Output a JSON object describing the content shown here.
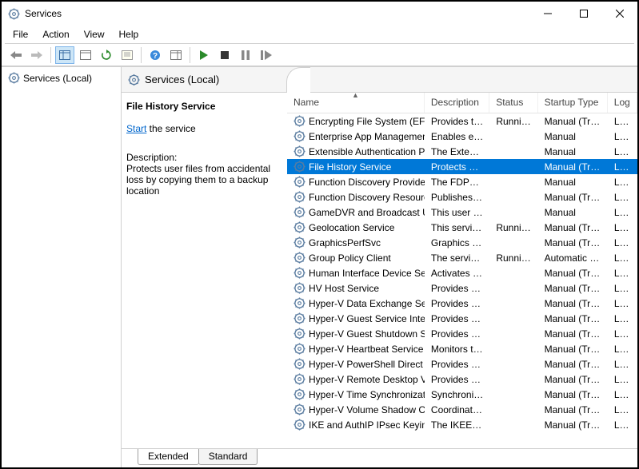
{
  "window": {
    "title": "Services"
  },
  "menu": {
    "file": "File",
    "action": "Action",
    "view": "View",
    "help": "Help"
  },
  "tree": {
    "root": "Services (Local)"
  },
  "header": {
    "title": "Services (Local)"
  },
  "detail": {
    "title": "File History Service",
    "start_label": "Start",
    "start_tail": " the service",
    "desc_head": "Description:",
    "desc_body": "Protects user files from accidental loss by copying them to a backup location"
  },
  "columns": {
    "name": "Name",
    "description": "Description",
    "status": "Status",
    "startup": "Startup Type",
    "logon": "Log"
  },
  "rows": [
    {
      "name": "Encrypting File System (EFS)",
      "desc": "Provides th...",
      "status": "Running",
      "startup": "Manual (Trig...",
      "logon": "Loca",
      "selected": false
    },
    {
      "name": "Enterprise App Managemen...",
      "desc": "Enables ent...",
      "status": "",
      "startup": "Manual",
      "logon": "Loca",
      "selected": false
    },
    {
      "name": "Extensible Authentication P...",
      "desc": "The Extensi...",
      "status": "",
      "startup": "Manual",
      "logon": "Loca",
      "selected": false
    },
    {
      "name": "File History Service",
      "desc": "Protects use...",
      "status": "",
      "startup": "Manual (Trig...",
      "logon": "Loca",
      "selected": true
    },
    {
      "name": "Function Discovery Provide...",
      "desc": "The FDPHO...",
      "status": "",
      "startup": "Manual",
      "logon": "Loca",
      "selected": false
    },
    {
      "name": "Function Discovery Resourc...",
      "desc": "Publishes th...",
      "status": "",
      "startup": "Manual (Trig...",
      "logon": "Loca",
      "selected": false
    },
    {
      "name": "GameDVR and Broadcast Us...",
      "desc": "This user ser...",
      "status": "",
      "startup": "Manual",
      "logon": "Loca",
      "selected": false
    },
    {
      "name": "Geolocation Service",
      "desc": "This service ...",
      "status": "Running",
      "startup": "Manual (Trig...",
      "logon": "Loca",
      "selected": false
    },
    {
      "name": "GraphicsPerfSvc",
      "desc": "Graphics pe...",
      "status": "",
      "startup": "Manual (Trig...",
      "logon": "Loca",
      "selected": false
    },
    {
      "name": "Group Policy Client",
      "desc": "The service i...",
      "status": "Running",
      "startup": "Automatic (T...",
      "logon": "Loca",
      "selected": false
    },
    {
      "name": "Human Interface Device Ser...",
      "desc": "Activates an...",
      "status": "",
      "startup": "Manual (Trig...",
      "logon": "Loca",
      "selected": false
    },
    {
      "name": "HV Host Service",
      "desc": "Provides an ...",
      "status": "",
      "startup": "Manual (Trig...",
      "logon": "Loca",
      "selected": false
    },
    {
      "name": "Hyper-V Data Exchange Ser...",
      "desc": "Provides a ...",
      "status": "",
      "startup": "Manual (Trig...",
      "logon": "Loca",
      "selected": false
    },
    {
      "name": "Hyper-V Guest Service Inter...",
      "desc": "Provides an ...",
      "status": "",
      "startup": "Manual (Trig...",
      "logon": "Loca",
      "selected": false
    },
    {
      "name": "Hyper-V Guest Shutdown S...",
      "desc": "Provides a ...",
      "status": "",
      "startup": "Manual (Trig...",
      "logon": "Loca",
      "selected": false
    },
    {
      "name": "Hyper-V Heartbeat Service",
      "desc": "Monitors th...",
      "status": "",
      "startup": "Manual (Trig...",
      "logon": "Loca",
      "selected": false
    },
    {
      "name": "Hyper-V PowerShell Direct ...",
      "desc": "Provides a ...",
      "status": "",
      "startup": "Manual (Trig...",
      "logon": "Loca",
      "selected": false
    },
    {
      "name": "Hyper-V Remote Desktop Vi...",
      "desc": "Provides a p...",
      "status": "",
      "startup": "Manual (Trig...",
      "logon": "Loca",
      "selected": false
    },
    {
      "name": "Hyper-V Time Synchronizati...",
      "desc": "Synchronize...",
      "status": "",
      "startup": "Manual (Trig...",
      "logon": "Loca",
      "selected": false
    },
    {
      "name": "Hyper-V Volume Shadow C...",
      "desc": "Coordinates...",
      "status": "",
      "startup": "Manual (Trig...",
      "logon": "Loca",
      "selected": false
    },
    {
      "name": "IKE and AuthIP IPsec Keying...",
      "desc": "The IKEEXT ...",
      "status": "",
      "startup": "Manual (Trig...",
      "logon": "Loca",
      "selected": false
    }
  ],
  "tabs": {
    "extended": "Extended",
    "standard": "Standard"
  }
}
